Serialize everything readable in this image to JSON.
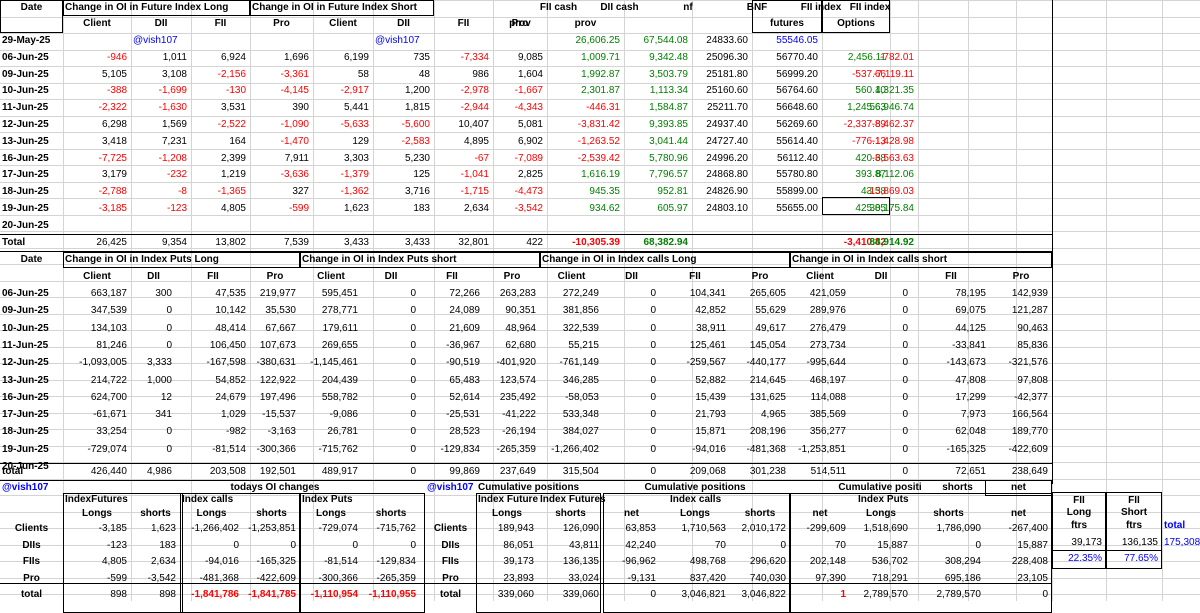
{
  "handle": "@vish107",
  "colors": {
    "negative": "#ff0000",
    "positive": "#008000",
    "handle": "#0000ff"
  },
  "t1": {
    "h_date": "Date",
    "h_long": "Change in OI in Future Index Long",
    "h_short": "Change in OI in Future Index Short",
    "h_fiicash": "FII cash",
    "h_diicash": "DII cash",
    "h_nf": "nf",
    "h_bnf": "BNF",
    "h_fiiidx": "FII index",
    "h_fiiidx2": "FII index",
    "sub": [
      "Client",
      "DII",
      "FII",
      "Pro",
      "Client",
      "DII",
      "FII",
      "Pro",
      "prov",
      "prov",
      "futures",
      "Options"
    ],
    "rows": [
      {
        "d": "29-May-25",
        "v": [
          "",
          "@vish107",
          "",
          "",
          "",
          "@vish107",
          "",
          "",
          "26,606.25",
          "67,544.08",
          "24833.60",
          "55546.05",
          "",
          ""
        ]
      },
      {
        "d": "06-Jun-25",
        "v": [
          "-946",
          "1,011",
          "6,924",
          "1,696",
          "6,199",
          "735",
          "-7,334",
          "9,085",
          "1,009.71",
          "9,342.48",
          "25096.30",
          "56770.40",
          "2,456.11",
          "-782.01"
        ]
      },
      {
        "d": "09-Jun-25",
        "v": [
          "5,105",
          "3,108",
          "-2,156",
          "-3,361",
          "58",
          "48",
          "986",
          "1,604",
          "1,992.87",
          "3,503.79",
          "25181.80",
          "56999.20",
          "-537.66",
          "-7,119.11"
        ]
      },
      {
        "d": "10-Jun-25",
        "v": [
          "-388",
          "-1,699",
          "-130",
          "-4,145",
          "-2,917",
          "1,200",
          "-2,978",
          "-1,667",
          "2,301.87",
          "1,113.34",
          "25160.60",
          "56764.60",
          "560.10",
          "4,321.35"
        ]
      },
      {
        "d": "11-Jun-25",
        "v": [
          "-2,322",
          "-1,630",
          "3,531",
          "390",
          "5,441",
          "1,815",
          "-2,944",
          "-4,343",
          "-446.31",
          "1,584.87",
          "25211.70",
          "56648.60",
          "1,245.63",
          "56,946.74"
        ]
      },
      {
        "d": "12-Jun-25",
        "v": [
          "6,298",
          "1,569",
          "-2,522",
          "-1,090",
          "-5,633",
          "-5,600",
          "10,407",
          "5,081",
          "-3,831.42",
          "9,393.85",
          "24937.40",
          "56269.60",
          "-2,337.89",
          "-8,462.37"
        ]
      },
      {
        "d": "13-Jun-25",
        "v": [
          "3,418",
          "7,231",
          "164",
          "-1,470",
          "129",
          "-2,583",
          "4,895",
          "6,902",
          "-1,263.52",
          "3,041.44",
          "24727.40",
          "55614.40",
          "-776.13",
          "-1,428.98"
        ]
      },
      {
        "d": "16-Jun-25",
        "v": [
          "-7,725",
          "-1,208",
          "2,399",
          "7,911",
          "3,303",
          "5,230",
          "-67",
          "-7,089",
          "-2,539.42",
          "5,780.96",
          "24996.20",
          "56112.40",
          "420.38",
          "-6,563.63"
        ]
      },
      {
        "d": "17-Jun-25",
        "v": [
          "3,179",
          "-232",
          "1,219",
          "-3,636",
          "-1,379",
          "125",
          "-1,041",
          "2,825",
          "1,616.19",
          "7,796.57",
          "24868.80",
          "55780.80",
          "393.87",
          "8,112.06"
        ]
      },
      {
        "d": "18-Jun-25",
        "v": [
          "-2,788",
          "-8",
          "-1,365",
          "327",
          "-1,362",
          "3,716",
          "-1,715",
          "-4,473",
          "945.35",
          "952.81",
          "24826.90",
          "55899.00",
          "43.58",
          "-13,869.03"
        ]
      },
      {
        "d": "19-Jun-25",
        "v": [
          "-3,185",
          "-123",
          "4,805",
          "-599",
          "1,623",
          "183",
          "2,634",
          "-3,542",
          "934.62",
          "605.97",
          "24803.10",
          "55655.00",
          "425.85",
          "30,175.84"
        ]
      },
      {
        "d": "20-Jun-25",
        "v": [
          "",
          "",
          "",
          "",
          "",
          "",
          "",
          "",
          "",
          "",
          "",
          "",
          "",
          ""
        ]
      }
    ],
    "total": {
      "d": "Total",
      "v": [
        "26,425",
        "9,354",
        "13,802",
        "7,539",
        "3,433",
        "3,433",
        "32,801",
        "422",
        "-10,305.39",
        "68,382.94",
        "",
        "",
        "-3,410.82",
        "84,914.92"
      ]
    }
  },
  "t2": {
    "h_date": "Date",
    "h_pl": "Change in OI in Index Puts Long",
    "h_ps": "Change in OI in Index Puts short",
    "h_cl": "Change in OI in Index calls Long",
    "h_cs": "Change in OI in Index calls short",
    "sub": [
      "Client",
      "DII",
      "FII",
      "Pro",
      "Client",
      "DII",
      "FII",
      "Pro",
      "Client",
      "DII",
      "FII",
      "Pro",
      "Client",
      "DII",
      "FII",
      "Pro"
    ],
    "rows": [
      {
        "d": "06-Jun-25",
        "v": [
          "663,187",
          "300",
          "47,535",
          "219,977",
          "595,451",
          "0",
          "72,266",
          "263,283",
          "272,249",
          "0",
          "104,341",
          "265,605",
          "421,059",
          "0",
          "78,195",
          "142,939"
        ]
      },
      {
        "d": "09-Jun-25",
        "v": [
          "347,539",
          "0",
          "10,142",
          "35,530",
          "278,771",
          "0",
          "24,089",
          "90,351",
          "381,856",
          "0",
          "42,852",
          "55,629",
          "289,976",
          "0",
          "69,075",
          "121,287"
        ]
      },
      {
        "d": "10-Jun-25",
        "v": [
          "134,103",
          "0",
          "48,414",
          "67,667",
          "179,611",
          "0",
          "21,609",
          "48,964",
          "322,539",
          "0",
          "38,911",
          "49,617",
          "276,479",
          "0",
          "44,125",
          "90,463"
        ]
      },
      {
        "d": "11-Jun-25",
        "v": [
          "81,246",
          "0",
          "106,450",
          "107,673",
          "269,655",
          "0",
          "-36,967",
          "62,680",
          "55,215",
          "0",
          "125,461",
          "145,054",
          "273,734",
          "0",
          "-33,841",
          "85,836"
        ]
      },
      {
        "d": "12-Jun-25",
        "v": [
          "-1,093,005",
          "3,333",
          "-167,598",
          "-380,631",
          "-1,145,461",
          "0",
          "-90,519",
          "-401,920",
          "-761,149",
          "0",
          "-259,567",
          "-440,177",
          "-995,644",
          "0",
          "-143,673",
          "-321,576"
        ]
      },
      {
        "d": "13-Jun-25",
        "v": [
          "214,722",
          "1,000",
          "54,852",
          "122,922",
          "204,439",
          "0",
          "65,483",
          "123,574",
          "346,285",
          "0",
          "52,882",
          "214,645",
          "468,197",
          "0",
          "47,808",
          "97,808"
        ]
      },
      {
        "d": "16-Jun-25",
        "v": [
          "624,700",
          "12",
          "24,679",
          "197,496",
          "558,782",
          "0",
          "52,614",
          "235,492",
          "-58,053",
          "0",
          "15,439",
          "131,625",
          "114,088",
          "0",
          "17,299",
          "-42,377"
        ]
      },
      {
        "d": "17-Jun-25",
        "v": [
          "-61,671",
          "341",
          "1,029",
          "-15,537",
          "-9,086",
          "0",
          "-25,531",
          "-41,222",
          "533,348",
          "0",
          "21,793",
          "4,965",
          "385,569",
          "0",
          "7,973",
          "166,564"
        ]
      },
      {
        "d": "18-Jun-25",
        "v": [
          "33,254",
          "0",
          "-982",
          "-3,163",
          "26,781",
          "0",
          "28,523",
          "-26,194",
          "384,027",
          "0",
          "15,871",
          "208,196",
          "356,277",
          "0",
          "62,048",
          "189,770"
        ]
      },
      {
        "d": "19-Jun-25",
        "v": [
          "-729,074",
          "0",
          "-81,514",
          "-300,366",
          "-715,762",
          "0",
          "-129,834",
          "-265,359",
          "-1,266,402",
          "0",
          "-94,016",
          "-481,368",
          "-1,253,851",
          "0",
          "-165,325",
          "-422,609"
        ]
      },
      {
        "d": "20-Jun-25",
        "v": [
          "",
          "",
          "",
          "",
          "",
          "",
          "",
          "",
          "",
          "",
          "",
          "",
          "",
          "",
          "",
          ""
        ]
      }
    ],
    "total": {
      "d": "total",
      "v": [
        "426,440",
        "4,986",
        "203,508",
        "192,501",
        "489,917",
        "0",
        "99,869",
        "237,649",
        "315,504",
        "0",
        "209,068",
        "301,238",
        "514,511",
        "0",
        "72,651",
        "238,649"
      ]
    }
  },
  "t3": {
    "h_todays": "todays OI changes",
    "h_idxfut": "IndexFutures",
    "h_idxcalls": "Index calls",
    "h_idxputs": "Index Puts",
    "sub": [
      "Longs",
      "shorts",
      "Longs",
      "shorts",
      "Longs",
      "shorts"
    ],
    "rows": [
      {
        "n": "Clients",
        "v": [
          "-3,185",
          "1,623",
          "-1,266,402",
          "-1,253,851",
          "-729,074",
          "-715,762"
        ]
      },
      {
        "n": "DIIs",
        "v": [
          "-123",
          "183",
          "0",
          "0",
          "0",
          "0"
        ]
      },
      {
        "n": "FIIs",
        "v": [
          "4,805",
          "2,634",
          "-94,016",
          "-165,325",
          "-81,514",
          "-129,834"
        ]
      },
      {
        "n": "Pro",
        "v": [
          "-599",
          "-3,542",
          "-481,368",
          "-422,609",
          "-300,366",
          "-265,359"
        ]
      },
      {
        "n": "total",
        "v": [
          "898",
          "898",
          "-1,841,786",
          "-1,841,785",
          "-1,110,954",
          "-1,110,955"
        ]
      }
    ]
  },
  "t4": {
    "h_cum1": "Cumulative positions",
    "h_cum2": "Cumulative positions",
    "h_cum3": "Cumulative positi",
    "h_shorts": "shorts",
    "h_net": "net",
    "h_if1": "Index Future",
    "h_if2": "Index Futures",
    "h_ic": "Index calls",
    "h_ip": "Index Puts",
    "sub": [
      "Longs",
      "shorts",
      "net",
      "Longs",
      "shorts",
      "net",
      "Longs",
      "shorts",
      "net"
    ],
    "rows": [
      {
        "n": "Clients",
        "v": [
          "189,943",
          "126,090",
          "63,853",
          "1,710,563",
          "2,010,172",
          "-299,609",
          "1,518,690",
          "1,786,090",
          "-267,400"
        ]
      },
      {
        "n": "DIIs",
        "v": [
          "86,051",
          "43,811",
          "42,240",
          "70",
          "0",
          "70",
          "15,887",
          "0",
          "15,887"
        ]
      },
      {
        "n": "FIIs",
        "v": [
          "39,173",
          "136,135",
          "-96,962",
          "498,768",
          "296,620",
          "202,148",
          "536,702",
          "308,294",
          "228,408"
        ]
      },
      {
        "n": "Pro",
        "v": [
          "23,893",
          "33,024",
          "-9,131",
          "837,420",
          "740,030",
          "97,390",
          "718,291",
          "695,186",
          "23,105"
        ]
      },
      {
        "n": "total",
        "v": [
          "339,060",
          "339,060",
          "0",
          "3,046,821",
          "3,046,822",
          "1",
          "2,789,570",
          "2,789,570",
          "0"
        ]
      }
    ]
  },
  "t5": {
    "h1a": "FII",
    "h1b": "Long",
    "h1c": "ftrs",
    "h2a": "FII",
    "h2b": "Short",
    "h2c": "ftrs",
    "h3": "total",
    "long": "39,173",
    "short": "136,135",
    "total": "175,308",
    "lpct": "22.35%",
    "spct": "77.65%"
  }
}
